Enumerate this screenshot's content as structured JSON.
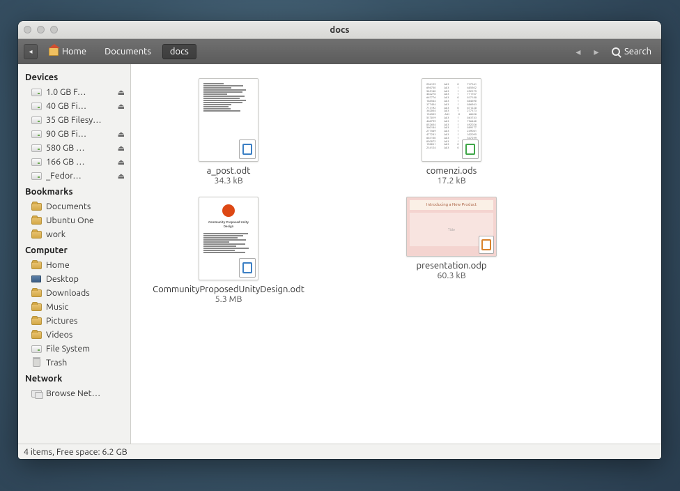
{
  "window_title": "docs",
  "breadcrumb": [
    {
      "label": "Home",
      "icon": "home"
    },
    {
      "label": "Documents"
    },
    {
      "label": "docs",
      "active": true
    }
  ],
  "search_label": "Search",
  "sidebar": {
    "sections": [
      {
        "title": "Devices",
        "items": [
          {
            "label": "1.0 GB F…",
            "icon": "drive",
            "eject": true
          },
          {
            "label": "40 GB Fi…",
            "icon": "drive",
            "eject": true
          },
          {
            "label": "35 GB Filesy…",
            "icon": "drive"
          },
          {
            "label": "90 GB Fi…",
            "icon": "drive",
            "eject": true
          },
          {
            "label": "580 GB …",
            "icon": "drive",
            "eject": true
          },
          {
            "label": "166 GB …",
            "icon": "drive",
            "eject": true
          },
          {
            "label": "_Fedor…",
            "icon": "drive",
            "eject": true
          }
        ]
      },
      {
        "title": "Bookmarks",
        "items": [
          {
            "label": "Documents",
            "icon": "folder"
          },
          {
            "label": "Ubuntu One",
            "icon": "folder"
          },
          {
            "label": "work",
            "icon": "folder"
          }
        ]
      },
      {
        "title": "Computer",
        "items": [
          {
            "label": "Home",
            "icon": "folder"
          },
          {
            "label": "Desktop",
            "icon": "desktop"
          },
          {
            "label": "Downloads",
            "icon": "folder"
          },
          {
            "label": "Music",
            "icon": "folder"
          },
          {
            "label": "Pictures",
            "icon": "folder"
          },
          {
            "label": "Videos",
            "icon": "folder"
          },
          {
            "label": "File System",
            "icon": "drive"
          },
          {
            "label": "Trash",
            "icon": "trash"
          }
        ]
      },
      {
        "title": "Network",
        "items": [
          {
            "label": "Browse Net…",
            "icon": "net"
          }
        ]
      }
    ]
  },
  "files": [
    {
      "name": "a_post.odt",
      "size": "34.3 kB",
      "type": "doc"
    },
    {
      "name": "comenzi.ods",
      "size": "17.2 kB",
      "type": "sheet"
    },
    {
      "name": "CommunityProposedUnityDesign.odt",
      "size": "5.3 MB",
      "type": "doc-ubuntu"
    },
    {
      "name": "presentation.odp",
      "size": "60.3 kB",
      "type": "pres"
    }
  ],
  "status": "4 items, Free space: 6.2 GB"
}
